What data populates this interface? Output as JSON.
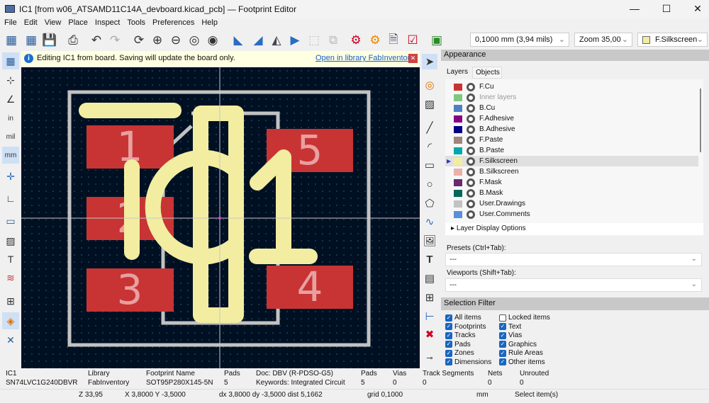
{
  "window": {
    "title": "IC1 [from w06_ATSAMD11C14A_devboard.kicad_pcb] — Footprint Editor"
  },
  "menu": [
    "File",
    "Edit",
    "View",
    "Place",
    "Inspect",
    "Tools",
    "Preferences",
    "Help"
  ],
  "toolbar": {
    "grid": "0,1000 mm (3,94 mils)",
    "zoom": "Zoom 35,00",
    "layer": "F.Silkscreen",
    "layer_color": "#f2eda1"
  },
  "infobar": {
    "message": "Editing IC1 from board.  Saving will update the board only.",
    "link": "Open in library FabInventory"
  },
  "canvas": {
    "pads": [
      "1",
      "2",
      "3",
      "4",
      "5"
    ],
    "reference": "IC1",
    "pad_color": "#c83434",
    "silk_color": "#f2eda1",
    "outline_color": "#c2c2c2"
  },
  "appearance": {
    "title": "Appearance",
    "tabs": [
      "Layers",
      "Objects"
    ],
    "layers": [
      {
        "name": "F.Cu",
        "color": "#c83434"
      },
      {
        "name": "Inner layers",
        "color": "#7fc87f",
        "dim": true
      },
      {
        "name": "B.Cu",
        "color": "#4d7fc4"
      },
      {
        "name": "F.Adhesive",
        "color": "#840084"
      },
      {
        "name": "B.Adhesive",
        "color": "#000084"
      },
      {
        "name": "F.Paste",
        "color": "#a0857c"
      },
      {
        "name": "B.Paste",
        "color": "#00a8a8"
      },
      {
        "name": "F.Silkscreen",
        "color": "#f2eda1",
        "active": true
      },
      {
        "name": "B.Silkscreen",
        "color": "#e8b2a7"
      },
      {
        "name": "F.Mask",
        "color": "#6a2a72"
      },
      {
        "name": "B.Mask",
        "color": "#02685a"
      },
      {
        "name": "User.Drawings",
        "color": "#c2c2c2"
      },
      {
        "name": "User.Comments",
        "color": "#598fdc"
      }
    ],
    "layer_display_options": "Layer Display Options",
    "presets_label": "Presets (Ctrl+Tab):",
    "presets_value": "---",
    "viewports_label": "Viewports (Shift+Tab):",
    "viewports_value": "---"
  },
  "selection_filter": {
    "title": "Selection Filter",
    "col1": [
      {
        "label": "All items",
        "checked": true
      },
      {
        "label": "Footprints",
        "checked": true
      },
      {
        "label": "Tracks",
        "checked": true
      },
      {
        "label": "Pads",
        "checked": true
      },
      {
        "label": "Zones",
        "checked": true
      },
      {
        "label": "Dimensions",
        "checked": true
      }
    ],
    "col2": [
      {
        "label": "Locked items",
        "checked": false
      },
      {
        "label": "Text",
        "checked": true
      },
      {
        "label": "Vias",
        "checked": true
      },
      {
        "label": "Graphics",
        "checked": true
      },
      {
        "label": "Rule Areas",
        "checked": true
      },
      {
        "label": "Other items",
        "checked": true
      }
    ]
  },
  "status": {
    "ref_label": "IC1",
    "ref_value": "SN74LVC1G240DBVR",
    "library_label": "Library",
    "library_value": "FabInventory",
    "fp_label": "Footprint Name",
    "fp_value": "SOT95P280X145-5N",
    "pads_label": "Pads",
    "pads_value": "5",
    "doc": "Doc: DBV (R-PDSO-G5)",
    "keywords": "Keywords: Integrated Circuit",
    "pads2_label": "Pads",
    "pads2_value": "5",
    "vias_label": "Vias",
    "vias_value": "0",
    "tracks_label": "Track Segments",
    "tracks_value": "0",
    "nets_label": "Nets",
    "nets_value": "0",
    "unrouted_label": "Unrouted",
    "unrouted_value": "0",
    "zoom": "Z 33,95",
    "xy": "X 3,8000  Y -3,5000",
    "delta": "dx 3,8000  dy -3,5000  dist 5,1662",
    "grid": "grid 0,1000",
    "units": "mm",
    "mode": "Select item(s)"
  }
}
